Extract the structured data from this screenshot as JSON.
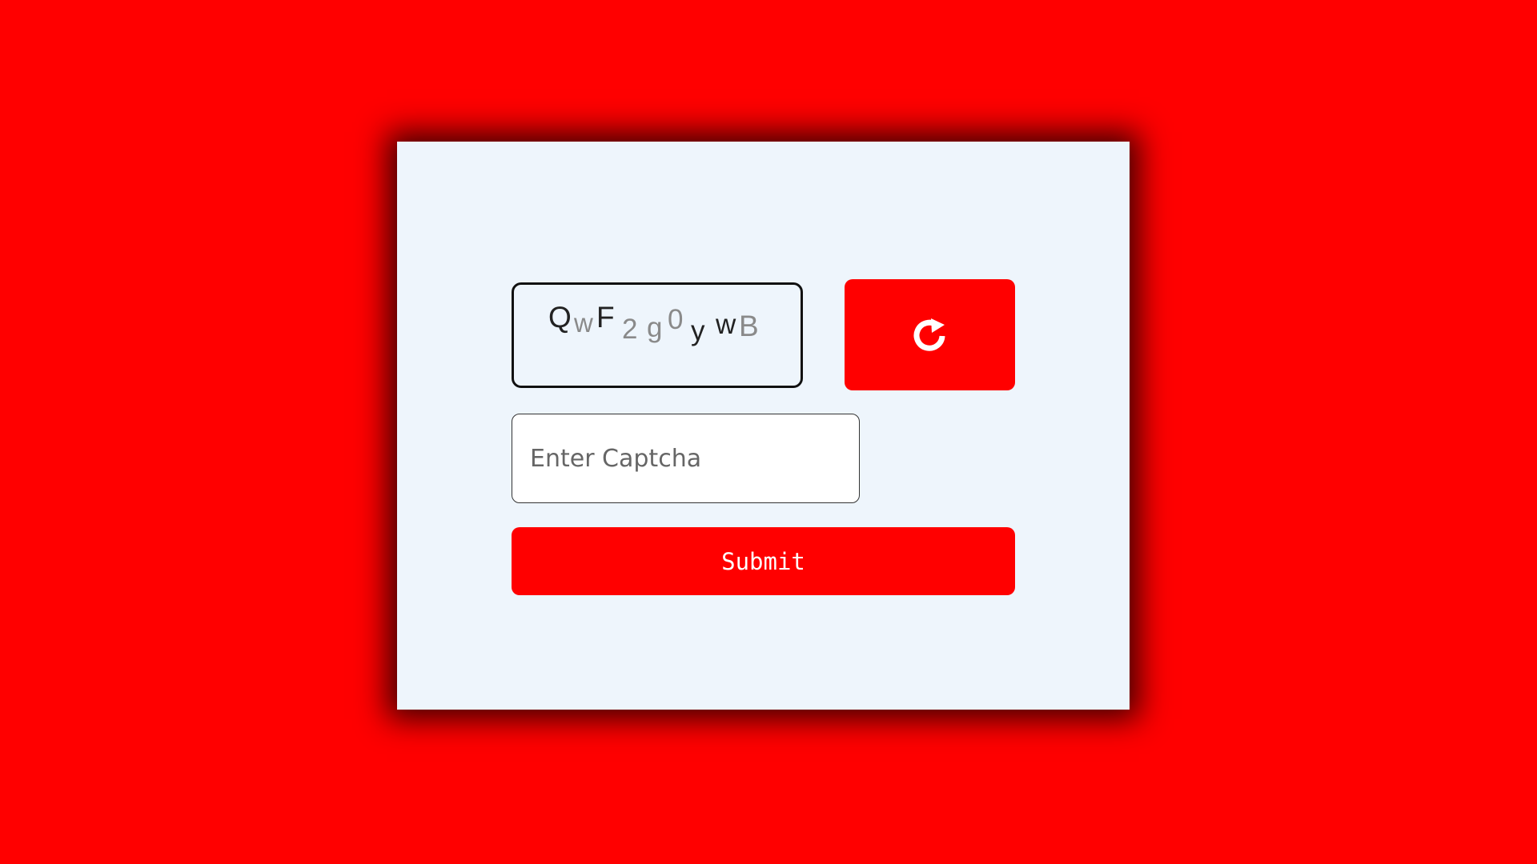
{
  "captcha": {
    "characters": [
      {
        "char": "Q",
        "color": "#222222"
      },
      {
        "char": "w",
        "color": "#8a8a8a"
      },
      {
        "char": "F",
        "color": "#222222"
      },
      {
        "char": "2",
        "color": "#8a8a8a"
      },
      {
        "char": "g",
        "color": "#8a8a8a"
      },
      {
        "char": "0",
        "color": "#8a8a8a"
      },
      {
        "char": "y",
        "color": "#222222"
      },
      {
        "char": "w",
        "color": "#222222"
      },
      {
        "char": "B",
        "color": "#8a8a8a"
      }
    ]
  },
  "refresh": {
    "icon": "refresh-icon"
  },
  "input": {
    "placeholder": "Enter Captcha",
    "value": ""
  },
  "submit": {
    "label": "Submit"
  },
  "colors": {
    "background": "#ff0000",
    "card": "#eef5fc",
    "accent": "#ff0000"
  }
}
